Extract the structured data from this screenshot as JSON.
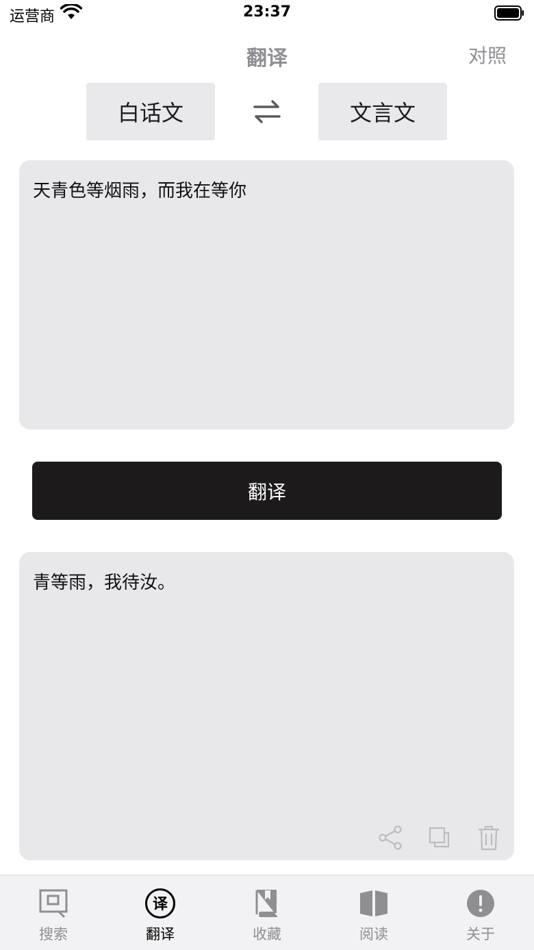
{
  "status_bar": {
    "carrier": "运营商",
    "time": "23:37"
  },
  "nav": {
    "title": "翻译",
    "compare_label": "对照"
  },
  "languages": {
    "source": "白话文",
    "target": "文言文"
  },
  "input": {
    "text": "天青色等烟雨，而我在等你"
  },
  "translate_button": "翻译",
  "output": {
    "text": "青等雨，我待汝。"
  },
  "tabs": [
    {
      "label": "搜索",
      "icon": "search-frame-icon",
      "active": false
    },
    {
      "label": "翻译",
      "icon": "translate-circle-icon",
      "active": true
    },
    {
      "label": "收藏",
      "icon": "bookmark-book-icon",
      "active": false
    },
    {
      "label": "阅读",
      "icon": "open-book-icon",
      "active": false
    },
    {
      "label": "关于",
      "icon": "info-exclamation-icon",
      "active": false
    }
  ],
  "translate_icon_glyph": "译",
  "colors": {
    "accent": "#1c1a1b",
    "box": "#e8e8eb",
    "inactive": "#8e8e93"
  }
}
